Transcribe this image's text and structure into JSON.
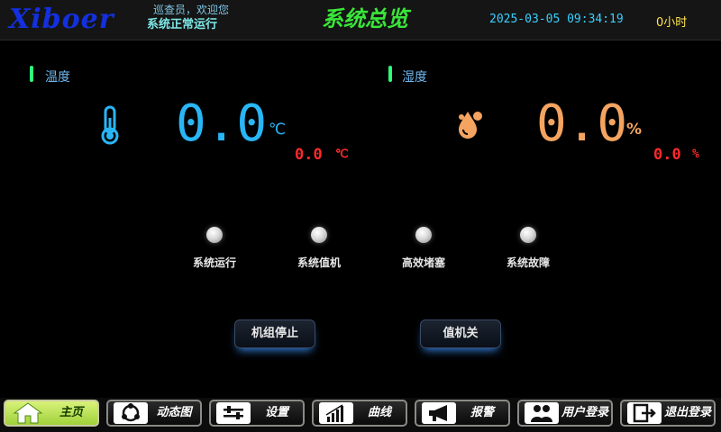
{
  "header": {
    "logo": "Xiboer",
    "greeting": "巡查员，欢迎您",
    "system_status": "系统正常运行",
    "title": "系统总览",
    "datetime": "2025-03-05 09:34:19",
    "run_hours": "0小时"
  },
  "temperature": {
    "label": "温度",
    "value": "0.0",
    "unit": "℃",
    "setpoint": "0.0",
    "setpoint_unit": "℃",
    "color": "#29b6f6"
  },
  "humidity": {
    "label": "湿度",
    "value": "0.0",
    "unit": "%",
    "setpoint": "0.0",
    "setpoint_unit": "%",
    "color": "#f4a460"
  },
  "indicators": [
    {
      "label": "系统运行",
      "icon": "status-led"
    },
    {
      "label": "系统值机",
      "icon": "status-led"
    },
    {
      "label": "高效堵塞",
      "icon": "status-led"
    },
    {
      "label": "系统故障",
      "icon": "status-led"
    }
  ],
  "controls": {
    "unit_stop": "机组停止",
    "duty_off": "值机关"
  },
  "nav": [
    {
      "label": "主页",
      "icon": "home-icon",
      "active": true
    },
    {
      "label": "动态图",
      "icon": "cycle-icon",
      "active": false
    },
    {
      "label": "设置",
      "icon": "sliders-icon",
      "active": false
    },
    {
      "label": "曲线",
      "icon": "chart-icon",
      "active": false
    },
    {
      "label": "报警",
      "icon": "megaphone-icon",
      "active": false
    },
    {
      "label": "用户登录",
      "icon": "users-icon",
      "active": false
    },
    {
      "label": "退出登录",
      "icon": "logout-icon",
      "active": false
    }
  ]
}
